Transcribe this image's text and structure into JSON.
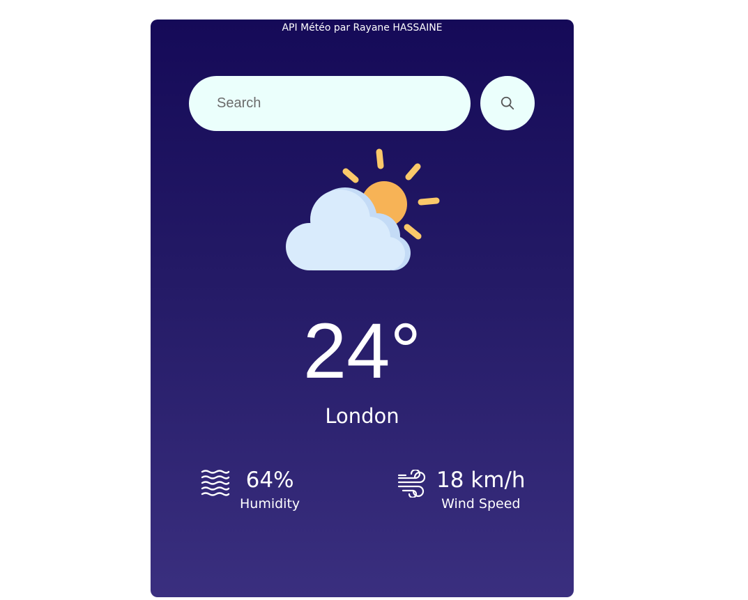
{
  "header": {
    "credit": "API Météo par Rayane HASSAINE"
  },
  "search": {
    "placeholder": "Search",
    "value": "",
    "button_icon": "search-icon"
  },
  "weather": {
    "icon": "partly-cloudy-sun-icon",
    "temperature": "24°",
    "city": "London"
  },
  "details": {
    "humidity": {
      "icon": "humidity-waves-icon",
      "value": "64%",
      "label": "Humidity"
    },
    "wind": {
      "icon": "wind-icon",
      "value": "18 km/h",
      "label": "Wind Speed"
    }
  },
  "colors": {
    "card_gradient_top": "#150a58",
    "card_gradient_bottom": "#3a2f7f",
    "input_background": "#ebfffc",
    "sun": "#f7b356",
    "sun_rays": "#fbc96a",
    "cloud": "#d9ebfc"
  }
}
